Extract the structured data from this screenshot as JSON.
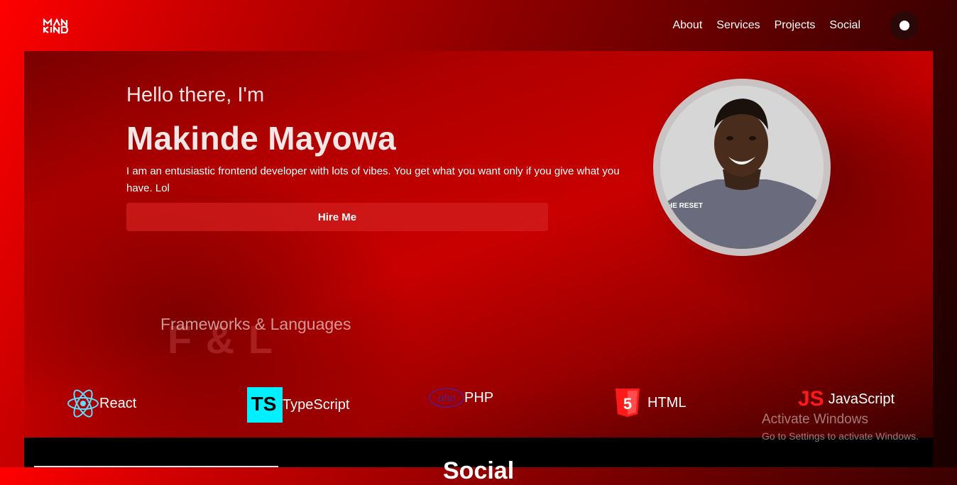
{
  "nav": {
    "logo_text": "MAN KIND",
    "items": [
      "About",
      "Services",
      "Projects",
      "Social"
    ]
  },
  "hero": {
    "greeting": "Hello there, I'm",
    "name": "Makinde Mayowa",
    "bio": "I am an entusiastic frontend developer with lots of vibes. You get what you want only if you give what you have. Lol",
    "hire_label": "Hire Me",
    "photo_shirt_text": "HE RESET"
  },
  "frameworks": {
    "watermark": "F & L",
    "title": "Frameworks & Languages",
    "items": [
      {
        "label": "React",
        "icon": "react-icon"
      },
      {
        "label": "TypeScript",
        "icon": "typescript-icon",
        "icon_text": "TS"
      },
      {
        "label": "PHP",
        "icon": "php-icon",
        "icon_text": "php"
      },
      {
        "label": "HTML",
        "icon": "html5-icon",
        "icon_text": "5"
      },
      {
        "label": "JavaScript",
        "icon": "javascript-icon",
        "icon_text": "JS"
      }
    ]
  },
  "footer": {
    "heading_partial": "Social"
  },
  "os_watermark": {
    "line1": "Activate Windows",
    "line2": "Go to Settings to activate Windows."
  },
  "colors": {
    "accent": "#ff0000",
    "typescript": "#00f0ff",
    "html": "#ff1a1a",
    "php": "#5b1a8a"
  }
}
